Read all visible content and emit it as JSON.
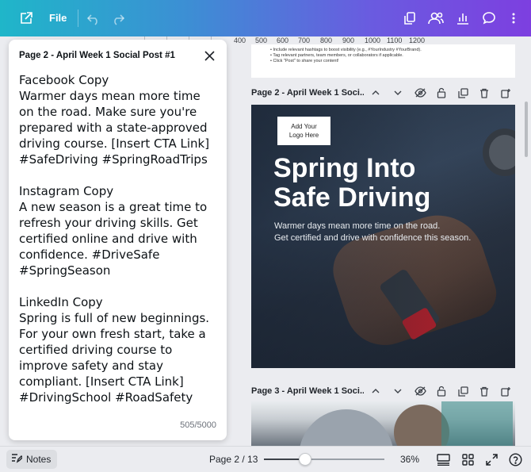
{
  "topbar": {
    "file_label": "File",
    "icons": {
      "open": "external-link-icon",
      "undo": "undo-icon",
      "redo": "redo-icon",
      "resize": "copy-pages-icon",
      "share": "people-icon",
      "insights": "bar-chart-icon",
      "comments": "comment-icon"
    },
    "gradient": [
      "#1fb6c9",
      "#7d3fe0"
    ]
  },
  "ruler": {
    "labels": [
      "400",
      "500",
      "600",
      "700",
      "800",
      "900",
      "1000",
      "1100",
      "1200"
    ]
  },
  "prev_page_text": [
    "• Include relevant hashtags to boost visibility (e.g., #YourIndustry #YourBrand).",
    "• Tag relevant partners, team members, or collaborators if applicable.",
    "• Click \"Post\" to share your content!"
  ],
  "pages": [
    {
      "title": "Page 2 - April Week 1 Soci..."
    },
    {
      "title": "Page 3 - April Week 1 Soci..."
    }
  ],
  "design": {
    "logo_placeholder": [
      "Add Your",
      "Logo Here"
    ],
    "headline": [
      "Spring Into",
      "Safe Driving"
    ],
    "subline": [
      "Warmer days mean more time on the road.",
      "Get certified and drive with confidence this season."
    ]
  },
  "notes": {
    "title": "Page 2 - April Week 1 Social Post #1",
    "lines": [
      "Facebook Copy",
      "Warmer days mean more time",
      "on the road. Make sure you're",
      "prepared with a state-approved",
      "driving course. [Insert CTA Link]",
      "#SafeDriving #SpringRoadTrips",
      "",
      "Instagram Copy",
      "A new season is a great time to",
      "refresh your driving skills. Get",
      "certified online and drive with",
      "confidence. #DriveSafe",
      "#SpringSeason",
      "",
      "LinkedIn Copy",
      "Spring is full of new beginnings.",
      "For your own fresh start, take a",
      "certified driving course to",
      "improve safety and stay",
      "compliant. [Insert CTA Link]",
      "#DrivingSchool #RoadSafety"
    ],
    "char_count": "505/5000"
  },
  "bottombar": {
    "notes_label": "Notes",
    "page_indicator": "Page 2 / 13",
    "zoom_label": "36%",
    "zoom_fraction": 0.34
  }
}
